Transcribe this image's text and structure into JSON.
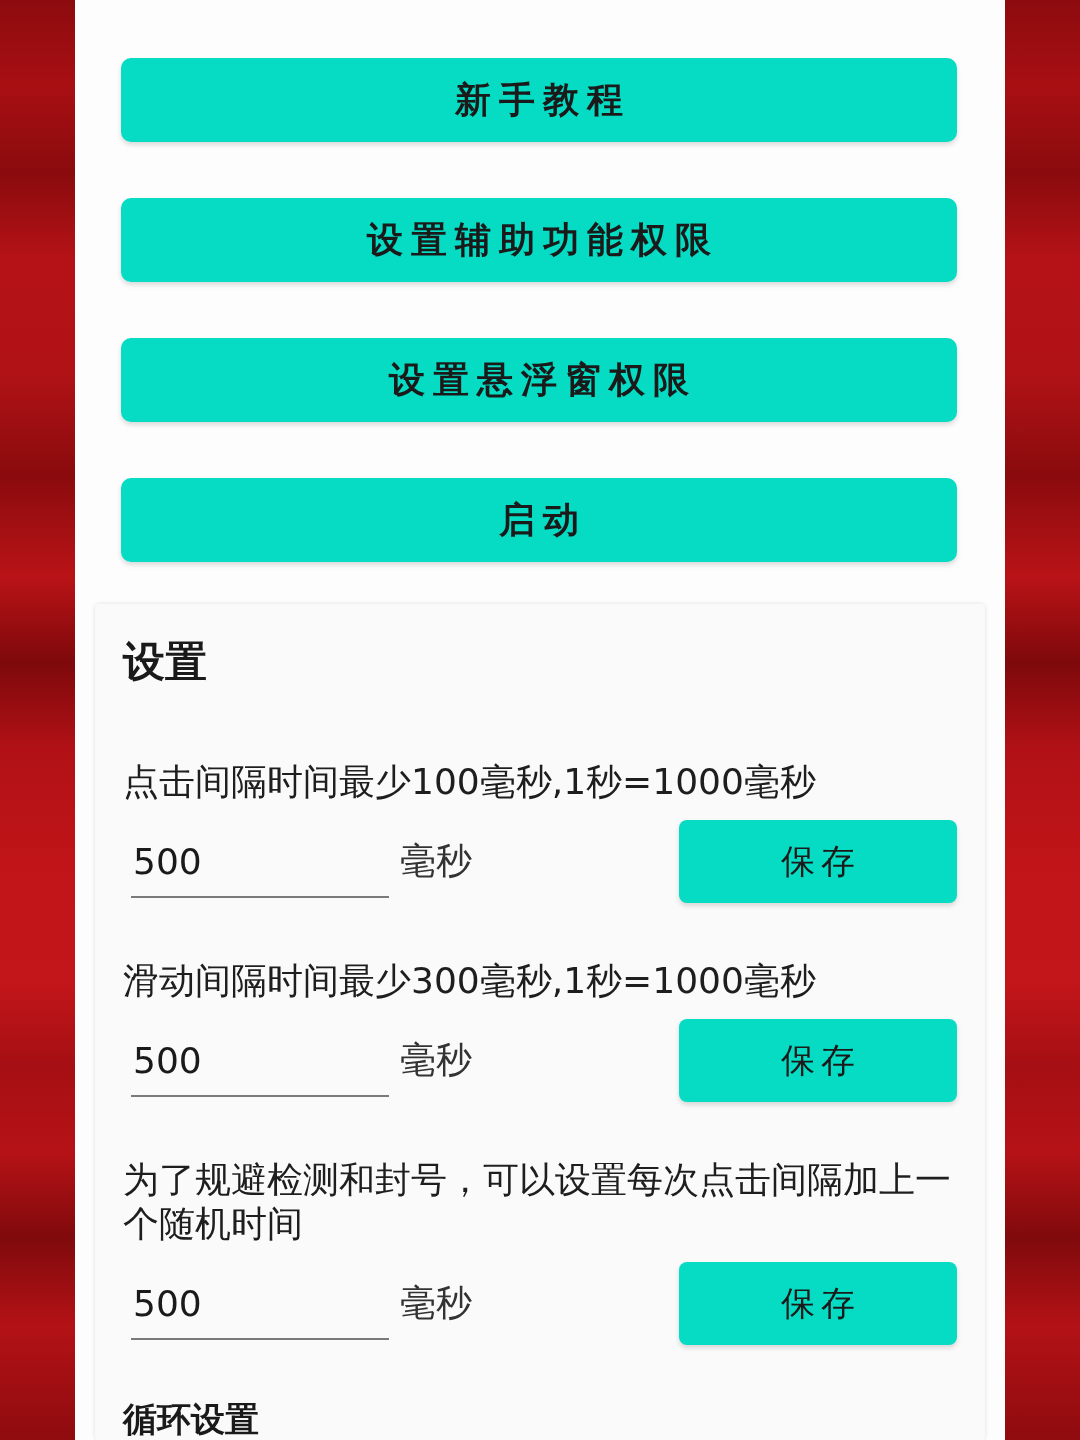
{
  "menu_buttons": [
    {
      "label": "新手教程"
    },
    {
      "label": "设置辅助功能权限"
    },
    {
      "label": "设置悬浮窗权限"
    },
    {
      "label": "启动"
    }
  ],
  "settings": {
    "title": "设置",
    "items": [
      {
        "description": "点击间隔时间最少100毫秒,1秒=1000毫秒",
        "value": "500",
        "unit": "毫秒",
        "button": "保存"
      },
      {
        "description": "滑动间隔时间最少300毫秒,1秒=1000毫秒",
        "value": "500",
        "unit": "毫秒",
        "button": "保存"
      },
      {
        "description": "为了规避检测和封号，可以设置每次点击间隔加上一个随机时间",
        "value": "500",
        "unit": "毫秒",
        "button": "保存"
      }
    ]
  },
  "next_section": {
    "title": "循环设置"
  }
}
